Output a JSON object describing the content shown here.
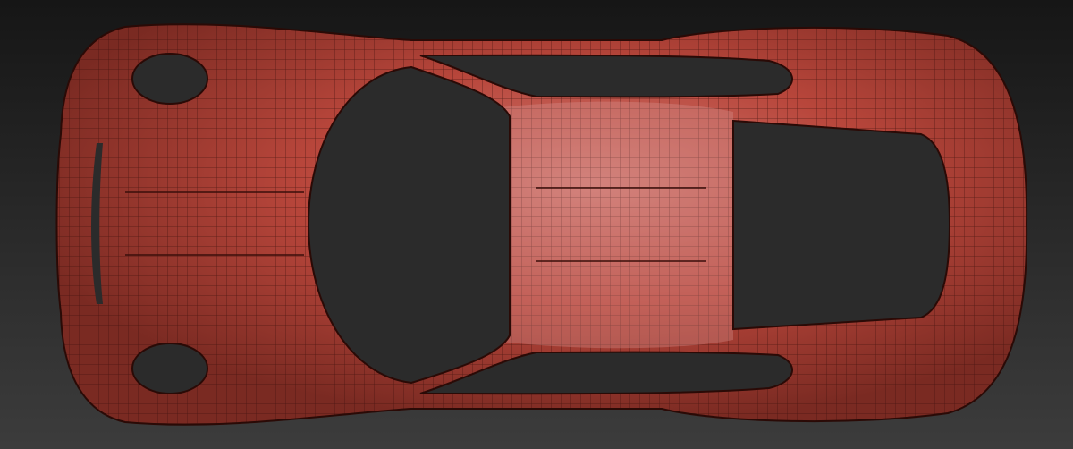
{
  "scene": {
    "subject": "car-wireframe-top-view",
    "colors": {
      "background_top": "#161616",
      "background_bottom": "#3c3c3c",
      "body": "#b8463b",
      "body_highlight": "#d98a86",
      "wire": "#3a0e0a",
      "glass": "#2b2b2b"
    }
  }
}
